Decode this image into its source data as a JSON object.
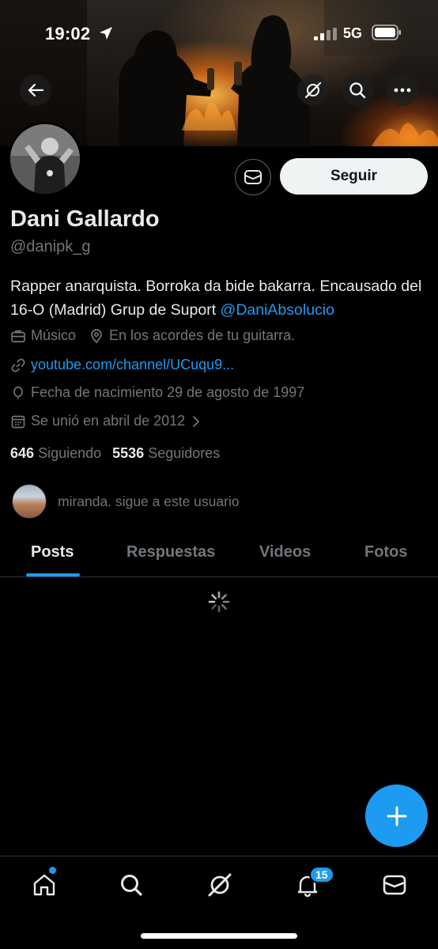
{
  "status_bar": {
    "time": "19:02",
    "network": "5G"
  },
  "profile": {
    "name": "Dani Gallardo",
    "handle": "@danipk_g",
    "bio_text": "Rapper anarquista. Borroka da bide bakarra. Encausado del 16-O (Madrid) Grup de Suport ",
    "bio_mention": "@DaniAbsolucio",
    "job": "Músico",
    "location": "En los acordes de tu guitarra.",
    "link": "youtube.com/channel/UCuqu9...",
    "birth": "Fecha de nacimiento 29 de agosto de 1997",
    "joined": "Se unió en abril de 2012",
    "following_count": "646",
    "following_label": "Siguiendo",
    "followers_count": "5536",
    "followers_label": "Seguidores"
  },
  "actions": {
    "follow_label": "Seguir"
  },
  "followed_by": {
    "text": "miranda. sigue a este usuario"
  },
  "tabs": [
    {
      "label": "Posts",
      "active": true
    },
    {
      "label": "Respuestas",
      "active": false
    },
    {
      "label": "Videos",
      "active": false
    },
    {
      "label": "Fotos",
      "active": false
    }
  ],
  "bottom_nav": {
    "items": [
      "home-icon",
      "search-icon",
      "grok-icon",
      "bell-icon",
      "mail-icon"
    ],
    "notifications_badge": "15"
  },
  "colors": {
    "accent": "#1d9bf0",
    "background": "#000000",
    "muted": "#71767b"
  }
}
